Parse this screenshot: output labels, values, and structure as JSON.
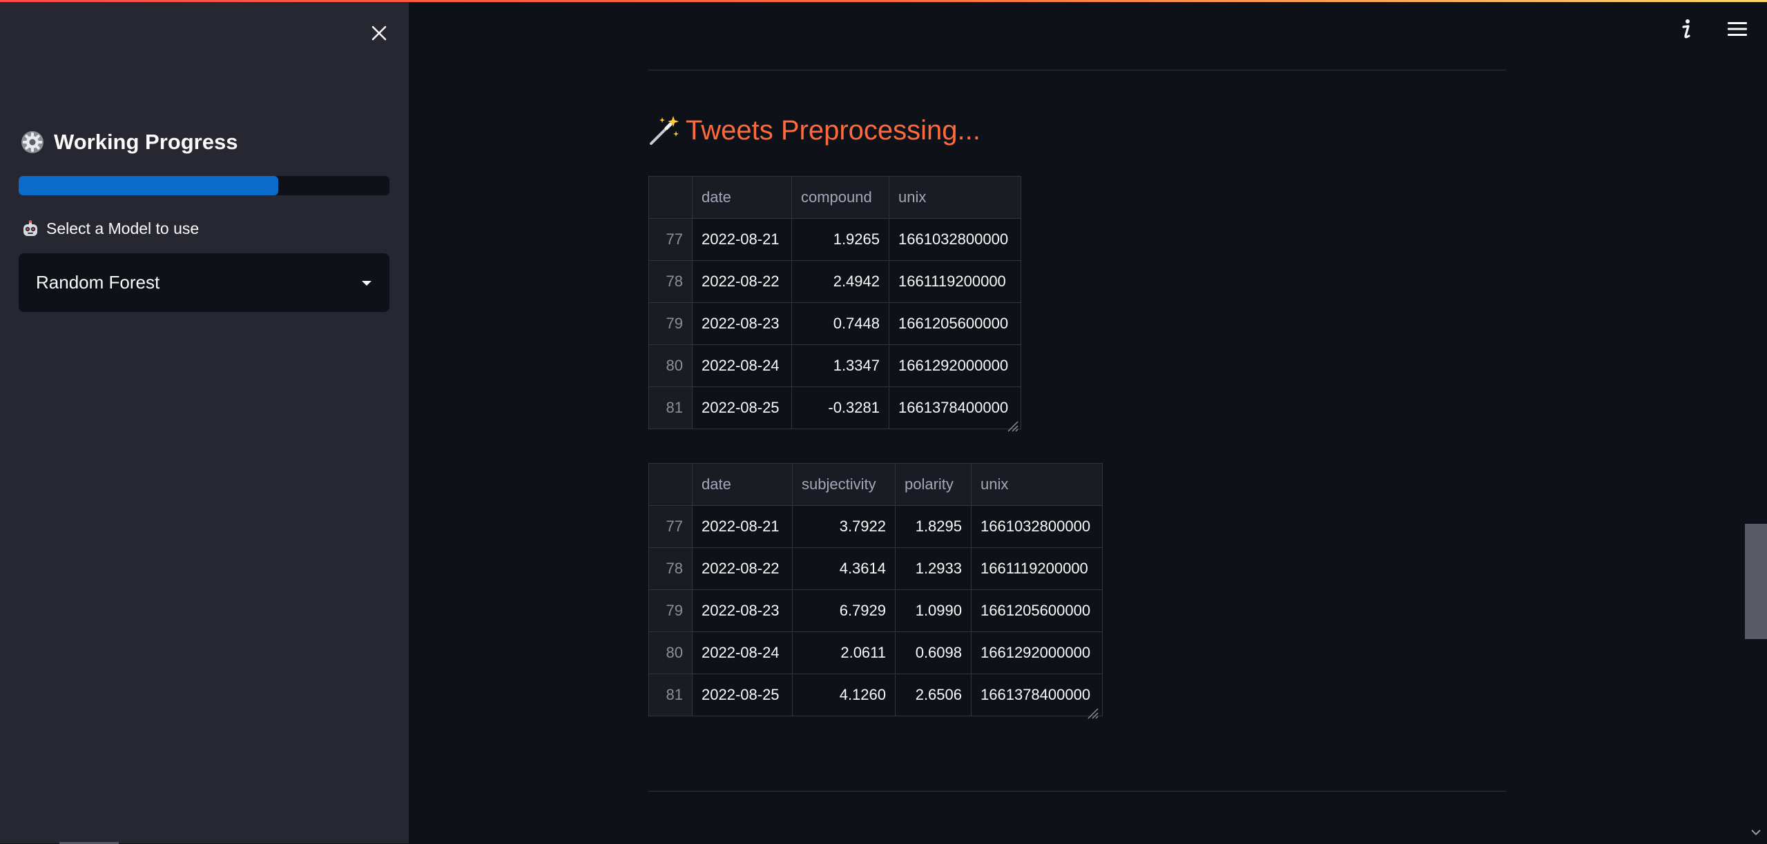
{
  "sidebar": {
    "title": "Working Progress",
    "title_icon": "gear-icon",
    "progress_fraction": 0.7,
    "select_label": "Select a Model to use",
    "select_label_icon": "robot-face-icon",
    "select_value": "Random Forest"
  },
  "header": {
    "info_icon": "info-icon",
    "menu_icon": "hamburger-menu-icon"
  },
  "main": {
    "section_title": "Tweets Preprocessing...",
    "section_icon": "magic-wand-icon",
    "table1": {
      "columns": [
        "",
        "date",
        "compound",
        "unix"
      ],
      "rows": [
        [
          "77",
          "2022-08-21",
          "1.9265",
          "1661032800000"
        ],
        [
          "78",
          "2022-08-22",
          "2.4942",
          "1661119200000"
        ],
        [
          "79",
          "2022-08-23",
          "0.7448",
          "1661205600000"
        ],
        [
          "80",
          "2022-08-24",
          "1.3347",
          "1661292000000"
        ],
        [
          "81",
          "2022-08-25",
          "-0.3281",
          "1661378400000"
        ]
      ]
    },
    "table2": {
      "columns": [
        "",
        "date",
        "subjectivity",
        "polarity",
        "unix"
      ],
      "rows": [
        [
          "77",
          "2022-08-21",
          "3.7922",
          "1.8295",
          "1661032800000"
        ],
        [
          "78",
          "2022-08-22",
          "4.3614",
          "1.2933",
          "1661119200000"
        ],
        [
          "79",
          "2022-08-23",
          "6.7929",
          "1.0990",
          "1661205600000"
        ],
        [
          "80",
          "2022-08-24",
          "2.0611",
          "0.6098",
          "1661292000000"
        ],
        [
          "81",
          "2022-08-25",
          "4.1260",
          "2.6506",
          "1661378400000"
        ]
      ]
    }
  },
  "colors": {
    "accent": "#ff6a3c",
    "progress": "#0b6bcb",
    "sidebar_bg": "#262730",
    "main_bg": "#0e1117"
  }
}
